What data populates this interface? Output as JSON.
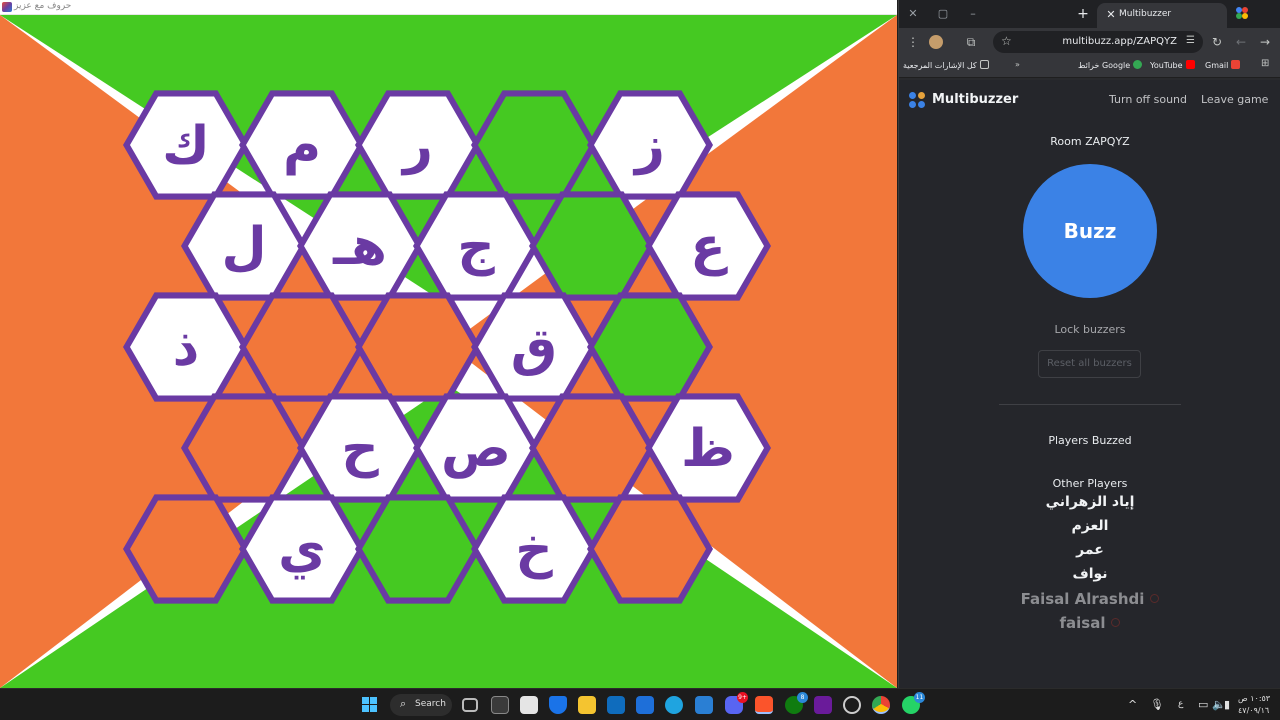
{
  "game_window": {
    "title": "حروف مع عزيز",
    "colors": {
      "orange": "#f2773a",
      "green": "#45c922",
      "purple": "#6a3aa3",
      "white": "#ffffff"
    },
    "board": {
      "rows": [
        [
          {
            "type": "letter",
            "char": "ك"
          },
          {
            "type": "letter",
            "char": "م"
          },
          {
            "type": "letter",
            "char": "ر"
          },
          {
            "type": "green"
          },
          {
            "type": "letter",
            "char": "ز"
          }
        ],
        [
          {
            "type": "letter",
            "char": "ل"
          },
          {
            "type": "letter",
            "char": "هـ"
          },
          {
            "type": "letter",
            "char": "ج"
          },
          {
            "type": "green"
          },
          {
            "type": "letter",
            "char": "ع"
          }
        ],
        [
          {
            "type": "letter",
            "char": "ذ"
          },
          {
            "type": "orange"
          },
          {
            "type": "orange"
          },
          {
            "type": "letter",
            "char": "ق"
          },
          {
            "type": "green"
          }
        ],
        [
          {
            "type": "orange"
          },
          {
            "type": "letter",
            "char": "ح"
          },
          {
            "type": "letter",
            "char": "ص"
          },
          {
            "type": "orange"
          },
          {
            "type": "letter",
            "char": "ظ"
          }
        ],
        [
          {
            "type": "orange"
          },
          {
            "type": "letter",
            "char": "ي"
          },
          {
            "type": "green"
          },
          {
            "type": "letter",
            "char": "خ"
          },
          {
            "type": "orange"
          }
        ]
      ]
    }
  },
  "browser": {
    "tab_title": "Multibuzzer",
    "url": "multibuzz.app/ZAPQYZ",
    "bookmarks": [
      {
        "label": "Gmail",
        "icon": "gmail-icon",
        "color": "#ea4335"
      },
      {
        "label": "YouTube",
        "icon": "youtube-icon",
        "color": "#ff0000"
      },
      {
        "label": "خرائط Google",
        "icon": "maps-icon",
        "color": "#34a853"
      },
      {
        "label": "كل الإشارات المرجعية",
        "icon": "folder-icon",
        "color": "#c4c7c5"
      }
    ]
  },
  "page": {
    "brand": "Multibuzzer",
    "turn_off_sound": "Turn off sound",
    "leave_game": "Leave game",
    "room": "Room ZAPQYZ",
    "buzz": "Buzz",
    "lock_buzzers": "Lock buzzers",
    "reset_all": "Reset all buzzers",
    "players_buzzed_heading": "Players Buzzed",
    "other_players_heading": "Other Players",
    "other_players": [
      {
        "name": "إياد الزهراني",
        "active": true
      },
      {
        "name": "العزم",
        "active": true
      },
      {
        "name": "عمر",
        "active": true
      },
      {
        "name": "نواف",
        "active": true
      },
      {
        "name": "Faisal Alrashdi",
        "active": false
      },
      {
        "name": "faisal",
        "active": false
      }
    ],
    "accent_color": "#3b82e6"
  },
  "taskbar": {
    "search_label": "Search",
    "clock_time": "١٠:٥٣ ص",
    "clock_date": "٤٧/٠٩/١٦",
    "language": "ع",
    "badges": {
      "discord": "9+",
      "xbox": "8",
      "whatsapp": "11"
    }
  }
}
